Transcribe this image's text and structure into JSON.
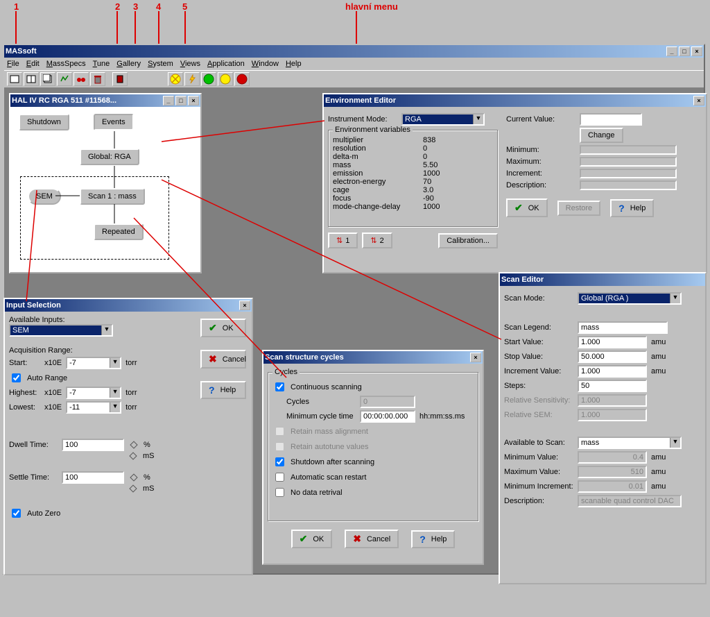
{
  "annotations": {
    "n1": "1",
    "n2": "2",
    "n3": "3",
    "n4": "4",
    "n5": "5",
    "main_menu": "hlavní menu"
  },
  "app": {
    "title": "MASsoft",
    "menu": {
      "file": "File",
      "edit": "Edit",
      "massspecs": "MassSpecs",
      "tune": "Tune",
      "gallery": "Gallery",
      "system": "System",
      "views": "Views",
      "application": "Application",
      "window": "Window",
      "help": "Help"
    }
  },
  "rga_window": {
    "title": "HAL IV RC RGA 511 #11568...",
    "shutdown": "Shutdown",
    "events": "Events",
    "global": "Global: RGA",
    "sem": "SEM",
    "scan1": "Scan 1 : mass",
    "repeated": "Repeated"
  },
  "env_editor": {
    "title": "Environment Editor",
    "instrument_mode_label": "Instrument Mode:",
    "instrument_mode_value": "RGA",
    "env_vars_label": "Environment variables",
    "vars": {
      "multiplier": {
        "k": "multiplier",
        "v": "838"
      },
      "resolution": {
        "k": "resolution",
        "v": "0"
      },
      "deltam": {
        "k": "delta-m",
        "v": "0"
      },
      "mass": {
        "k": "mass",
        "v": "5.50"
      },
      "emission": {
        "k": "emission",
        "v": "1000"
      },
      "electron_energy": {
        "k": "electron-energy",
        "v": "70"
      },
      "cage": {
        "k": "cage",
        "v": "3.0"
      },
      "focus": {
        "k": "focus",
        "v": "-90"
      },
      "mode_change_delay": {
        "k": "mode-change-delay",
        "v": "1000"
      }
    },
    "btn1": "1",
    "btn2": "2",
    "calibration": "Calibration...",
    "current_value_label": "Current Value:",
    "change": "Change",
    "minimum": "Minimum:",
    "maximum": "Maximum:",
    "increment": "Increment:",
    "description": "Description:",
    "ok": "OK",
    "restore": "Restore",
    "help": "Help"
  },
  "input_sel": {
    "title": "Input Selection",
    "available_inputs": "Available Inputs:",
    "available_value": "SEM",
    "acq_range": "Acquisition Range:",
    "start": "Start:",
    "x10e": "x10E",
    "start_val": "-7",
    "auto_range": "Auto Range",
    "highest": "Highest:",
    "highest_val": "-7",
    "lowest": "Lowest:",
    "lowest_val": "-11",
    "torr": "torr",
    "dwell_time": "Dwell Time:",
    "dwell_val": "100",
    "settle_time": "Settle Time:",
    "settle_val": "100",
    "pct": "%",
    "ms": "mS",
    "auto_zero": "Auto Zero",
    "ok": "OK",
    "cancel": "Cancel",
    "help": "Help"
  },
  "scan_cycles": {
    "title": "Scan structure cycles",
    "group": "Cycles",
    "continuous": "Continuous scanning",
    "cycles": "Cycles",
    "cycles_val": "0",
    "min_cycle_time": "Minimum cycle time",
    "min_cycle_val": "00:00:00.000",
    "hhmmss": "hh:mm:ss.ms",
    "retain_mass": "Retain mass alignment",
    "retain_autotune": "Retain autotune values",
    "shutdown_after": "Shutdown after scanning",
    "auto_restart": "Automatic scan restart",
    "no_data": "No data retrival",
    "ok": "OK",
    "cancel": "Cancel",
    "help": "Help"
  },
  "scan_editor": {
    "title": "Scan Editor",
    "scan_mode_label": "Scan Mode:",
    "scan_mode_value": "Global (RGA )",
    "scan_legend_label": "Scan Legend:",
    "scan_legend_value": "mass",
    "start_label": "Start Value:",
    "start_value": "1.000",
    "stop_label": "Stop Value:",
    "stop_value": "50.000",
    "inc_label": "Increment Value:",
    "inc_value": "1.000",
    "steps_label": "Steps:",
    "steps_value": "50",
    "rel_sens_label": "Relative Sensitivity:",
    "rel_sens_value": "1.000",
    "rel_sem_label": "Relative SEM:",
    "rel_sem_value": "1.000",
    "amu": "amu",
    "avail_label": "Available to Scan:",
    "avail_value": "mass",
    "min_val_label": "Minimum Value:",
    "min_val": "0.4",
    "max_val_label": "Maximum Value:",
    "max_val": "510",
    "min_inc_label": "Minimum Increment:",
    "min_inc": "0.01",
    "desc_label": "Description:",
    "desc_value": "scanable quad control DAC"
  }
}
